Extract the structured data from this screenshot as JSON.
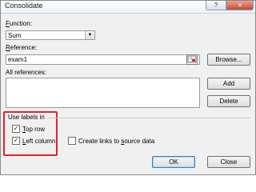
{
  "window": {
    "title": "Consolidate",
    "help_glyph": "?",
    "close_glyph": "✕"
  },
  "function": {
    "label_key": "F",
    "label_rest": "unction:",
    "selected": "Sum"
  },
  "reference": {
    "label_key": "R",
    "label_rest": "eference:",
    "value": "exam1",
    "browse_label": "Browse..."
  },
  "all_references": {
    "label": "All references:",
    "add_label": "Add",
    "delete_label": "Delete"
  },
  "labels_group": {
    "title": "Use labels in",
    "top_row_key": "T",
    "top_row_rest": "op row",
    "left_column_key": "L",
    "left_column_rest": "eft column",
    "top_row_checked": true,
    "left_column_checked": true
  },
  "links": {
    "label_pre": "Create links to ",
    "label_key": "s",
    "label_post": "ource data",
    "checked": false
  },
  "footer": {
    "ok_label": "OK",
    "close_label": "Close"
  },
  "colors": {
    "highlight": "#e0242a"
  }
}
